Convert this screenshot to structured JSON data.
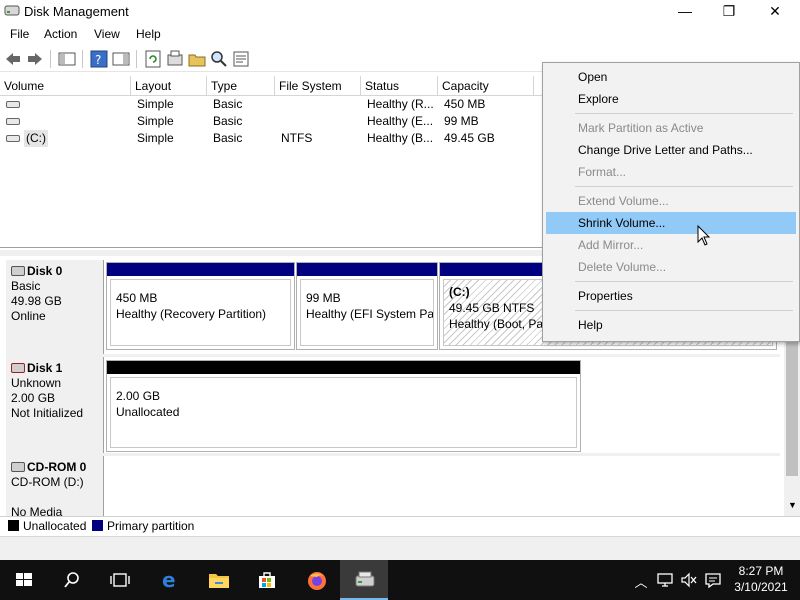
{
  "window": {
    "title": "Disk Management",
    "controls": {
      "minimize": "—",
      "maximize": "❐",
      "close": "✕"
    }
  },
  "menubar": [
    "File",
    "Action",
    "View",
    "Help"
  ],
  "volume_list": {
    "columns": [
      "Volume",
      "Layout",
      "Type",
      "File System",
      "Status",
      "Capacity"
    ],
    "rows": [
      {
        "volume": "",
        "layout": "Simple",
        "type": "Basic",
        "fs": "",
        "status": "Healthy (R...",
        "capacity": "450 MB"
      },
      {
        "volume": "",
        "layout": "Simple",
        "type": "Basic",
        "fs": "",
        "status": "Healthy (E...",
        "capacity": "99 MB"
      },
      {
        "volume": "(C:)",
        "layout": "Simple",
        "type": "Basic",
        "fs": "NTFS",
        "status": "Healthy (B...",
        "capacity": "49.45 GB"
      }
    ]
  },
  "disks": [
    {
      "name": "Disk 0",
      "kind": "Basic",
      "size": "49.98 GB",
      "state": "Online",
      "partitions": [
        {
          "line1": "450 MB",
          "line2": "Healthy (Recovery Partition)"
        },
        {
          "line1": "99 MB",
          "line2": "Healthy (EFI System Part"
        },
        {
          "title": "(C:)",
          "line1": "49.45 GB NTFS",
          "line2": "Healthy (Boot, Pag"
        }
      ]
    },
    {
      "name": "Disk 1",
      "kind": "Unknown",
      "size": "2.00 GB",
      "state": "Not Initialized",
      "partitions": [
        {
          "line1": "2.00 GB",
          "line2": "Unallocated"
        }
      ]
    },
    {
      "name": "CD-ROM 0",
      "kind": "CD-ROM (D:)",
      "size": "",
      "state": "No Media",
      "partitions": []
    }
  ],
  "legend": [
    {
      "label": "Unallocated",
      "color": "#000000"
    },
    {
      "label": "Primary partition",
      "color": "#000080"
    }
  ],
  "context_menu": {
    "items": [
      {
        "label": "Open",
        "enabled": true
      },
      {
        "label": "Explore",
        "enabled": true
      },
      {
        "label": "Mark Partition as Active",
        "enabled": false
      },
      {
        "label": "Change Drive Letter and Paths...",
        "enabled": true
      },
      {
        "label": "Format...",
        "enabled": false
      },
      {
        "label": "Extend Volume...",
        "enabled": false
      },
      {
        "label": "Shrink Volume...",
        "enabled": true,
        "highlighted": true
      },
      {
        "label": "Add Mirror...",
        "enabled": false
      },
      {
        "label": "Delete Volume...",
        "enabled": false
      },
      {
        "label": "Properties",
        "enabled": true
      },
      {
        "label": "Help",
        "enabled": true
      }
    ]
  },
  "taskbar": {
    "time": "8:27 PM",
    "date": "3/10/2021",
    "pinned": [
      "start-icon",
      "search-icon",
      "task-view-icon",
      "edge-icon",
      "file-explorer-icon",
      "store-icon",
      "firefox-icon",
      "disk-management-icon"
    ],
    "tray": [
      "chevron-up-icon",
      "network-icon",
      "volume-muted-icon",
      "notification-icon"
    ]
  },
  "colors": {
    "primary_partition": "#000080",
    "unallocated": "#000000",
    "menu_highlight": "#91c9f7"
  }
}
